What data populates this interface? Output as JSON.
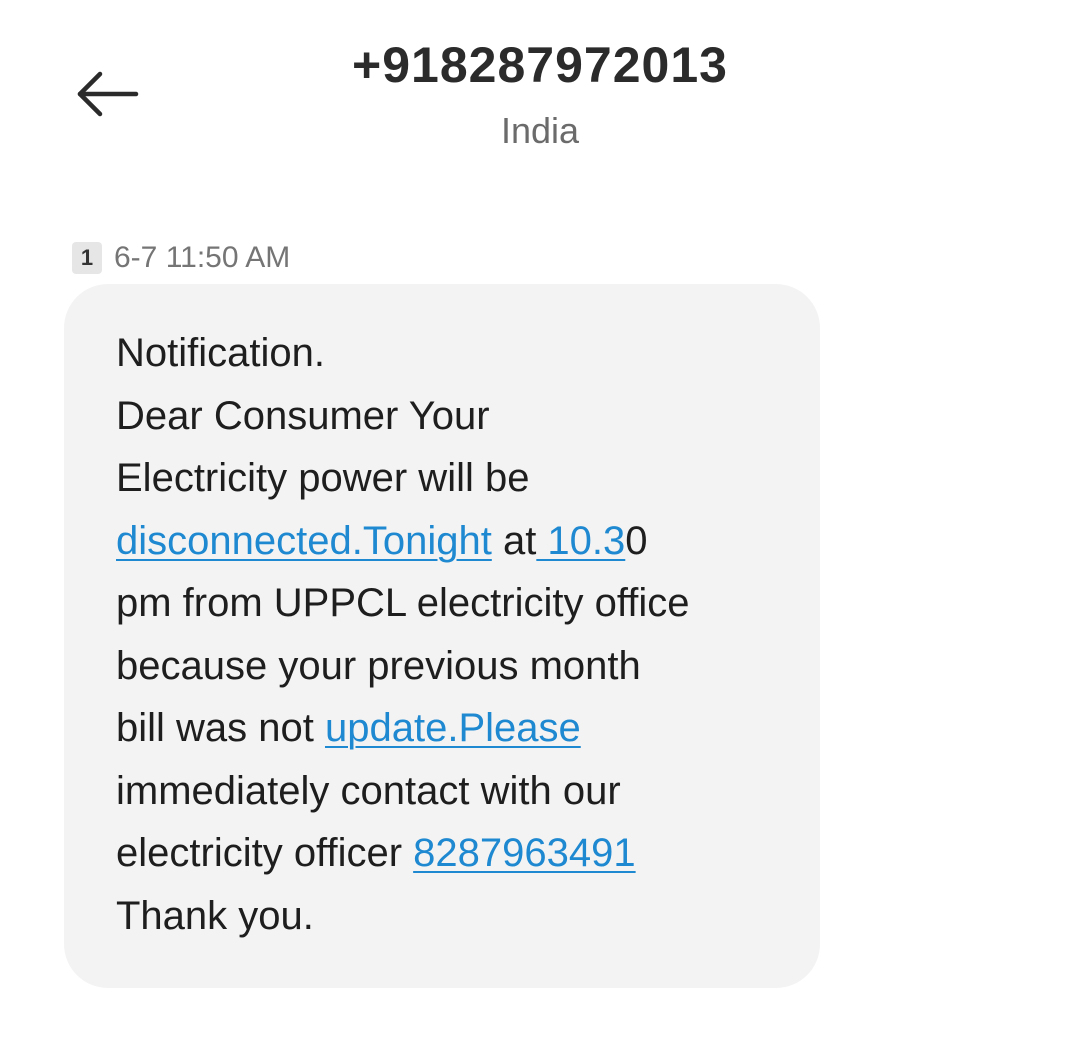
{
  "header": {
    "back_icon": "arrow-left-icon",
    "title": "+918287972013",
    "subtitle": "India"
  },
  "message": {
    "sim_badge": "1",
    "timestamp": "6-7 11:50 AM",
    "colors": {
      "link": "#1e88d0",
      "bubble": "#f3f3f3"
    },
    "lines": [
      {
        "t1": "Notification."
      },
      {
        "t1": "Dear Consumer Your"
      },
      {
        "t1": "Electricity power will be"
      },
      {
        "l1": "disconnected.Tonight",
        "t2": " at",
        "l2": " 10.3",
        "t3": "0"
      },
      {
        "t1": "pm from UPPCL electricity office"
      },
      {
        "t1": "because your previous month"
      },
      {
        "t1": "bill was not ",
        "l1": "update.Please"
      },
      {
        "t1": "immediately contact with our"
      },
      {
        "t1": "electricity officer ",
        "l1": "8287963491"
      },
      {
        "t1": "Thank you."
      }
    ]
  }
}
